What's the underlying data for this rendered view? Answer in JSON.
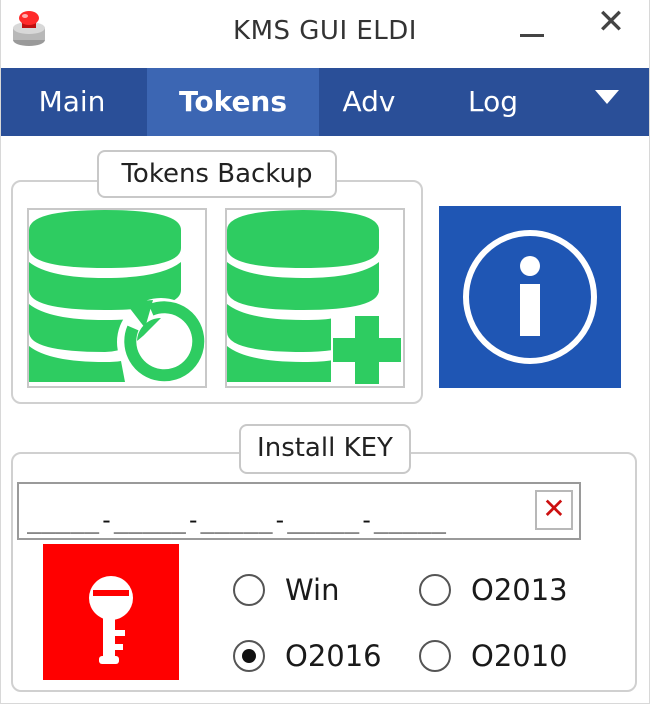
{
  "window": {
    "title": "KMS GUI ELDI",
    "close_glyph": "✕"
  },
  "tabs": [
    {
      "label": "Main",
      "active": false
    },
    {
      "label": "Tokens",
      "active": true
    },
    {
      "label": "Adv",
      "active": false
    },
    {
      "label": "Log",
      "active": false
    }
  ],
  "tokens_backup": {
    "label": "Tokens Backup",
    "restore_icon": "database-restore-icon",
    "add_icon": "database-add-icon",
    "info_icon": "info-icon"
  },
  "install_key": {
    "label": "Install KEY",
    "key_value": "_____-_____-_____-_____-_____",
    "clear_glyph": "✕",
    "key_icon": "key-icon",
    "radios": [
      {
        "label": "Win",
        "checked": false
      },
      {
        "label": "O2013",
        "checked": false
      },
      {
        "label": "O2016",
        "checked": true
      },
      {
        "label": "O2010",
        "checked": false
      }
    ]
  },
  "colors": {
    "tabbar": "#2a4f98",
    "tab_active": "#3c66b3",
    "db_green": "#2ecc61",
    "info_blue": "#1f56b4",
    "key_red": "#ff0000"
  }
}
